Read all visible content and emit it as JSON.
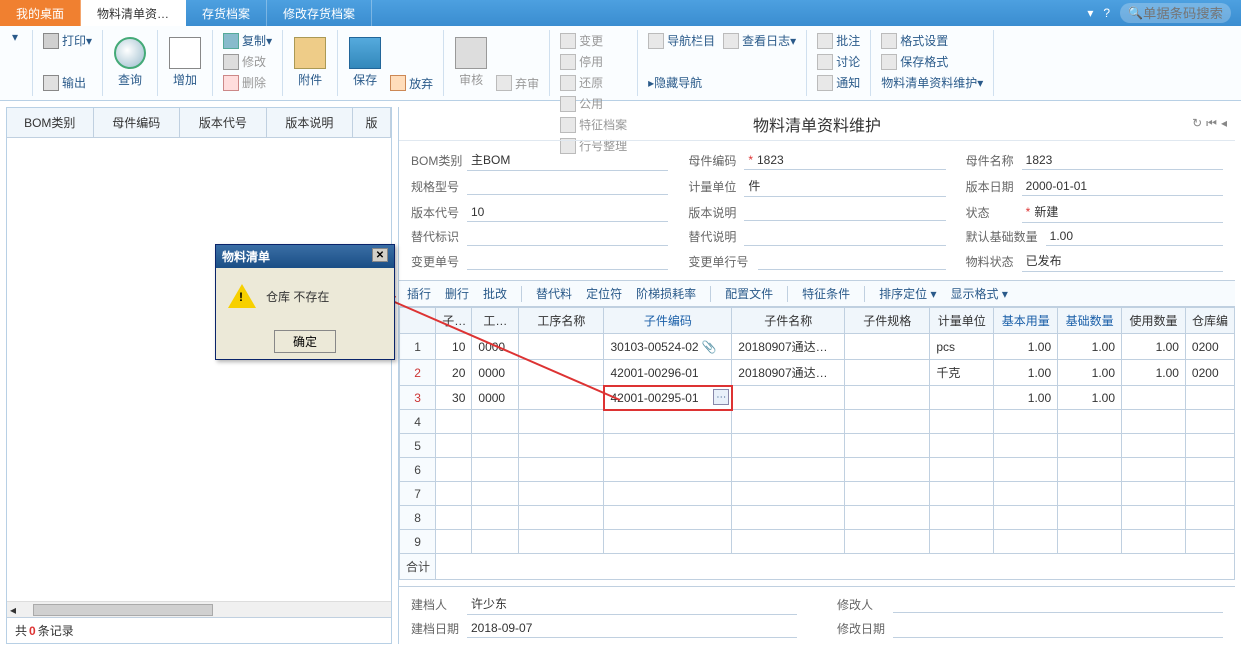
{
  "titlebar": {
    "tabs": [
      "我的桌面",
      "物料清单资…",
      "存货档案",
      "修改存货档案"
    ],
    "search_placeholder": "单据条码搜索"
  },
  "ribbon": {
    "print": "打印",
    "export": "输出",
    "query": "查询",
    "add": "增加",
    "copy": "复制",
    "modify": "修改",
    "delete": "删除",
    "attach": "附件",
    "save": "保存",
    "discard": "放弃",
    "audit": "审核",
    "abandon": "弃审",
    "change": "变更",
    "public": "公用",
    "disable": "停用",
    "feature_file": "特征档案",
    "restore": "还原",
    "row_arrange": "行号整理",
    "nav_bar": "导航栏目",
    "view_log": "查看日志",
    "hide_nav": "隐藏导航",
    "batch_note": "批注",
    "discuss": "讨论",
    "notify": "通知",
    "format_set": "格式设置",
    "save_format": "保存格式",
    "maintain": "物料清单资料维护"
  },
  "left": {
    "headers": [
      "BOM类别",
      "母件编码",
      "版本代号",
      "版本说明",
      "版"
    ],
    "footer_prefix": "共",
    "footer_count": "0",
    "footer_suffix": "条记录"
  },
  "dialog": {
    "title": "物料清单",
    "message": "仓库  不存在",
    "ok": "确定"
  },
  "page": {
    "title": "物料清单资料维护",
    "form": {
      "bom_type_label": "BOM类别",
      "bom_type": "主BOM",
      "parent_code_label": "母件编码",
      "parent_code": "1823",
      "parent_name_label": "母件名称",
      "parent_name": "1823",
      "spec_label": "规格型号",
      "spec": "",
      "unit_label": "计量单位",
      "unit": "件",
      "ver_date_label": "版本日期",
      "ver_date": "2000-01-01",
      "ver_code_label": "版本代号",
      "ver_code": "10",
      "ver_desc_label": "版本说明",
      "ver_desc": "",
      "status_label": "状态",
      "status": "新建",
      "alt_flag_label": "替代标识",
      "alt_flag": "",
      "alt_desc_label": "替代说明",
      "alt_desc": "",
      "default_qty_label": "默认基础数量",
      "default_qty": "1.00",
      "change_no_label": "变更单号",
      "change_no": "",
      "change_row_label": "变更单行号",
      "change_row": "",
      "mat_status_label": "物料状态",
      "mat_status": "已发布"
    },
    "toolbar": {
      "insert_row": "插行",
      "delete_row": "删行",
      "batch_modify": "批改",
      "alt_material": "替代料",
      "locator": "定位符",
      "step_loss": "阶梯损耗率",
      "config_file": "配置文件",
      "feature_cond": "特征条件",
      "sort_locate": "排序定位",
      "display_format": "显示格式"
    },
    "columns": [
      "子…",
      "工…",
      "工序名称",
      "子件编码",
      "子件名称",
      "子件规格",
      "计量单位",
      "基本用量",
      "基础数量",
      "使用数量",
      "仓库编"
    ],
    "rows": [
      {
        "n": "1",
        "c1": "10",
        "c2": "0000",
        "code": "30103-00524-02",
        "has_attach": true,
        "name": "20180907通达…",
        "spec": "",
        "uom": "pcs",
        "qty": "1.00",
        "base": "1.00",
        "use": "1.00",
        "wh": "0200"
      },
      {
        "n": "2",
        "c1": "20",
        "c2": "0000",
        "code": "42001-00296-01",
        "has_attach": false,
        "name": "20180907通达…",
        "spec": "",
        "uom": "千克",
        "qty": "1.00",
        "base": "1.00",
        "use": "1.00",
        "wh": "0200"
      },
      {
        "n": "3",
        "c1": "30",
        "c2": "0000",
        "code": "42001-00295-01",
        "has_attach": false,
        "name": "",
        "spec": "",
        "uom": "",
        "qty": "1.00",
        "base": "1.00",
        "use": "",
        "wh": ""
      }
    ],
    "sum_label": "合计",
    "footer": {
      "creator_label": "建档人",
      "creator": "许少东",
      "modifier_label": "修改人",
      "modifier": "",
      "create_date_label": "建档日期",
      "create_date": "2018-09-07",
      "modify_date_label": "修改日期",
      "modify_date": ""
    }
  }
}
